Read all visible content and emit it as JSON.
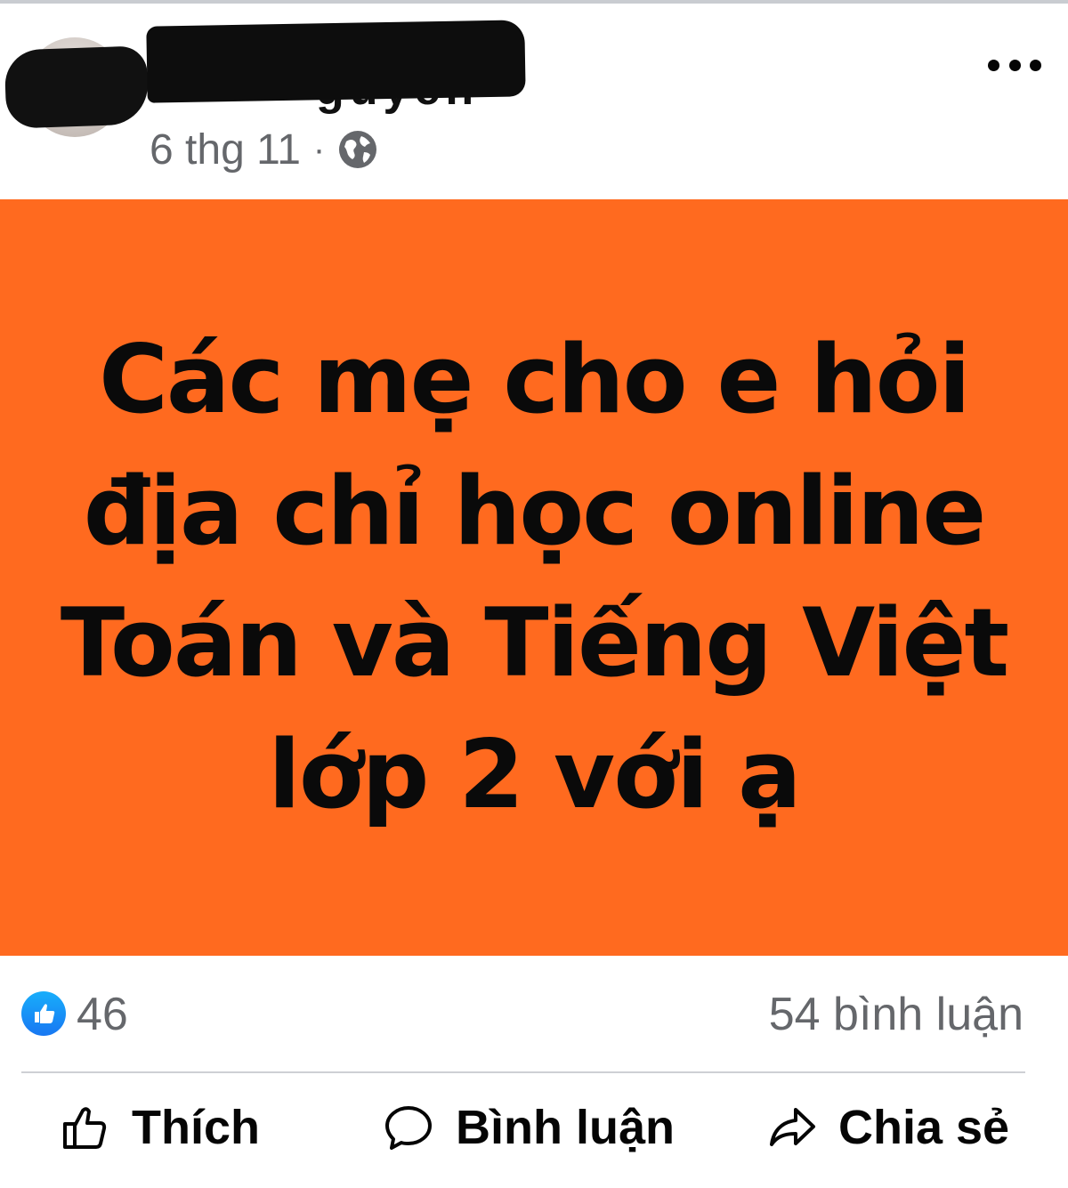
{
  "post": {
    "date": "6 thg 11",
    "separator": "·",
    "privacy_icon": "globe-icon",
    "more_icon": "more-options-icon",
    "image_text": "Các mẹ cho e hỏi địa chỉ học online Toán và Tiếng Việt lớp 2 với ạ",
    "image_background": "#ff6a1f"
  },
  "reactions": {
    "like_count": "46",
    "comment_count": "54 bình luận",
    "accent": "#1877f2"
  },
  "actions": {
    "like_label": "Thích",
    "comment_label": "Bình luận",
    "share_label": "Chia sẻ"
  }
}
